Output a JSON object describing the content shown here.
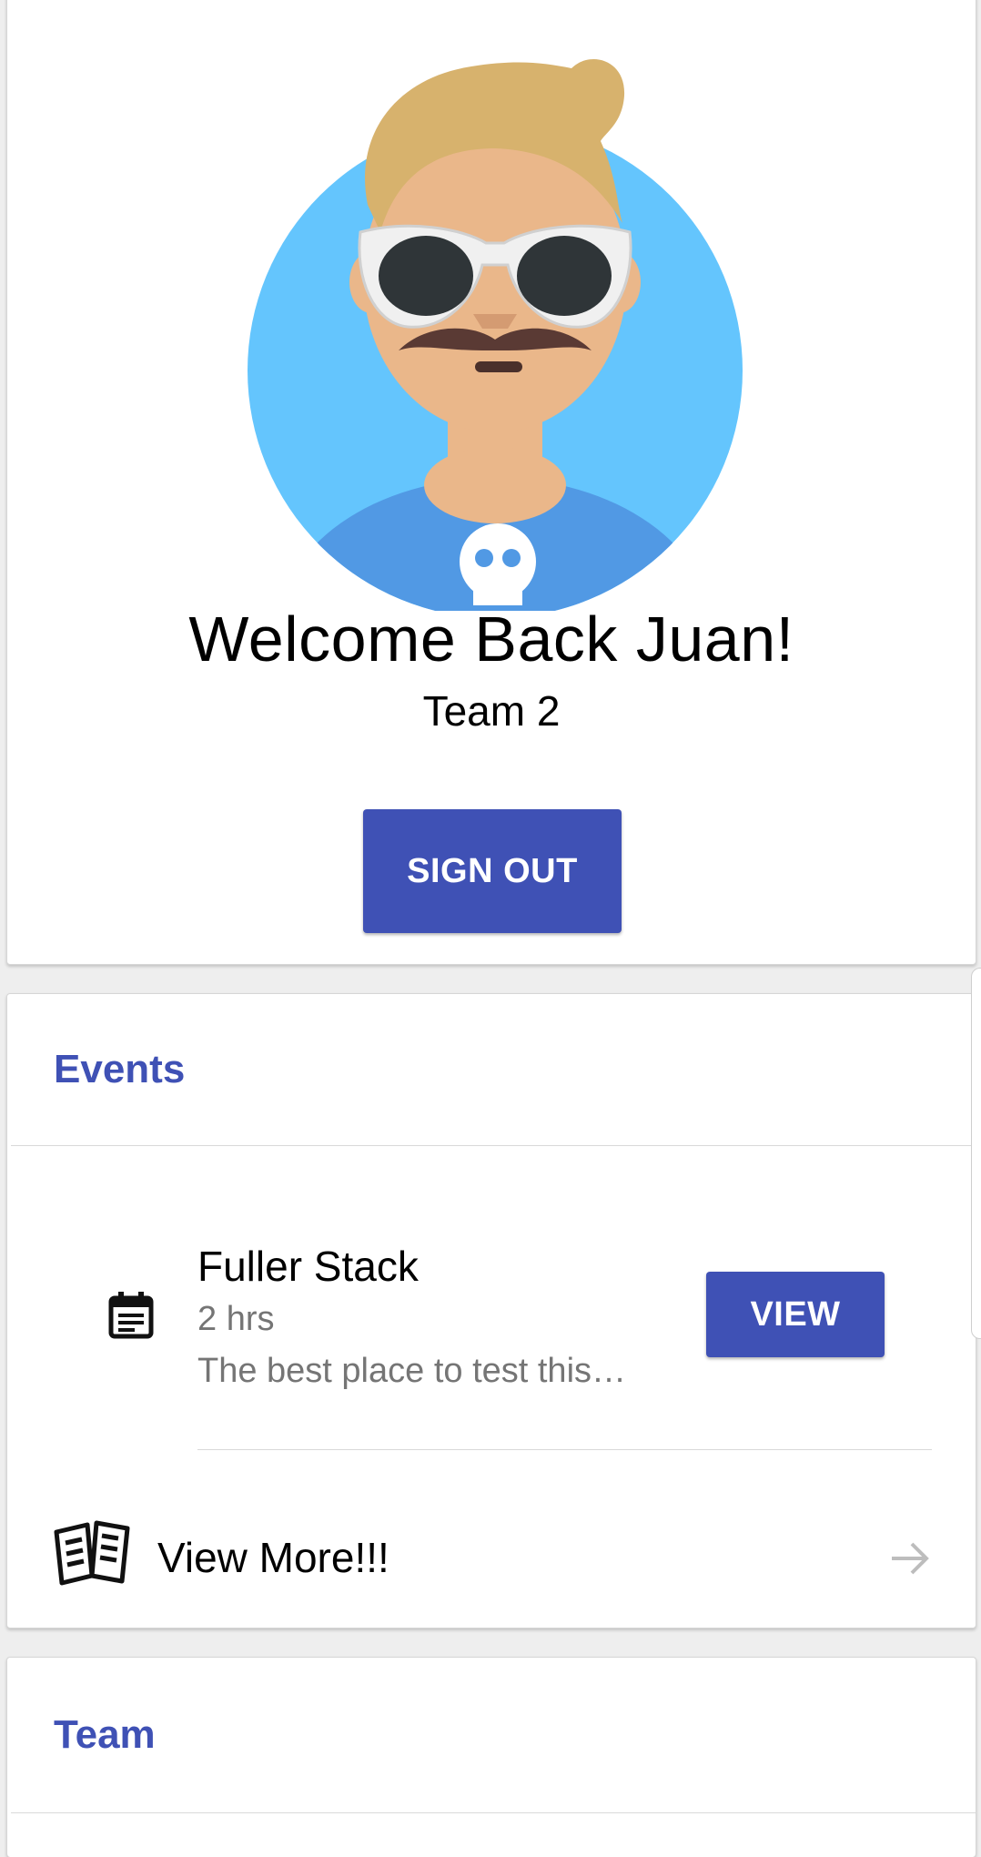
{
  "profile": {
    "welcome_text": "Welcome Back Juan!",
    "team_text": "Team 2",
    "sign_out_label": "SIGN OUT"
  },
  "events": {
    "title": "Events",
    "items": [
      {
        "title": "Fuller Stack",
        "duration": "2 hrs",
        "description": "The best place to test this…",
        "view_label": "VIEW"
      }
    ],
    "view_more_label": "View More!!!"
  },
  "team": {
    "title": "Team"
  },
  "colors": {
    "primary": "#3f51b5",
    "avatar_bg": "#64c5fd",
    "secondary_text": "#757575"
  },
  "icons": [
    "avatar-illustration",
    "event-note-icon",
    "book-open-icon",
    "arrow-right-icon"
  ]
}
